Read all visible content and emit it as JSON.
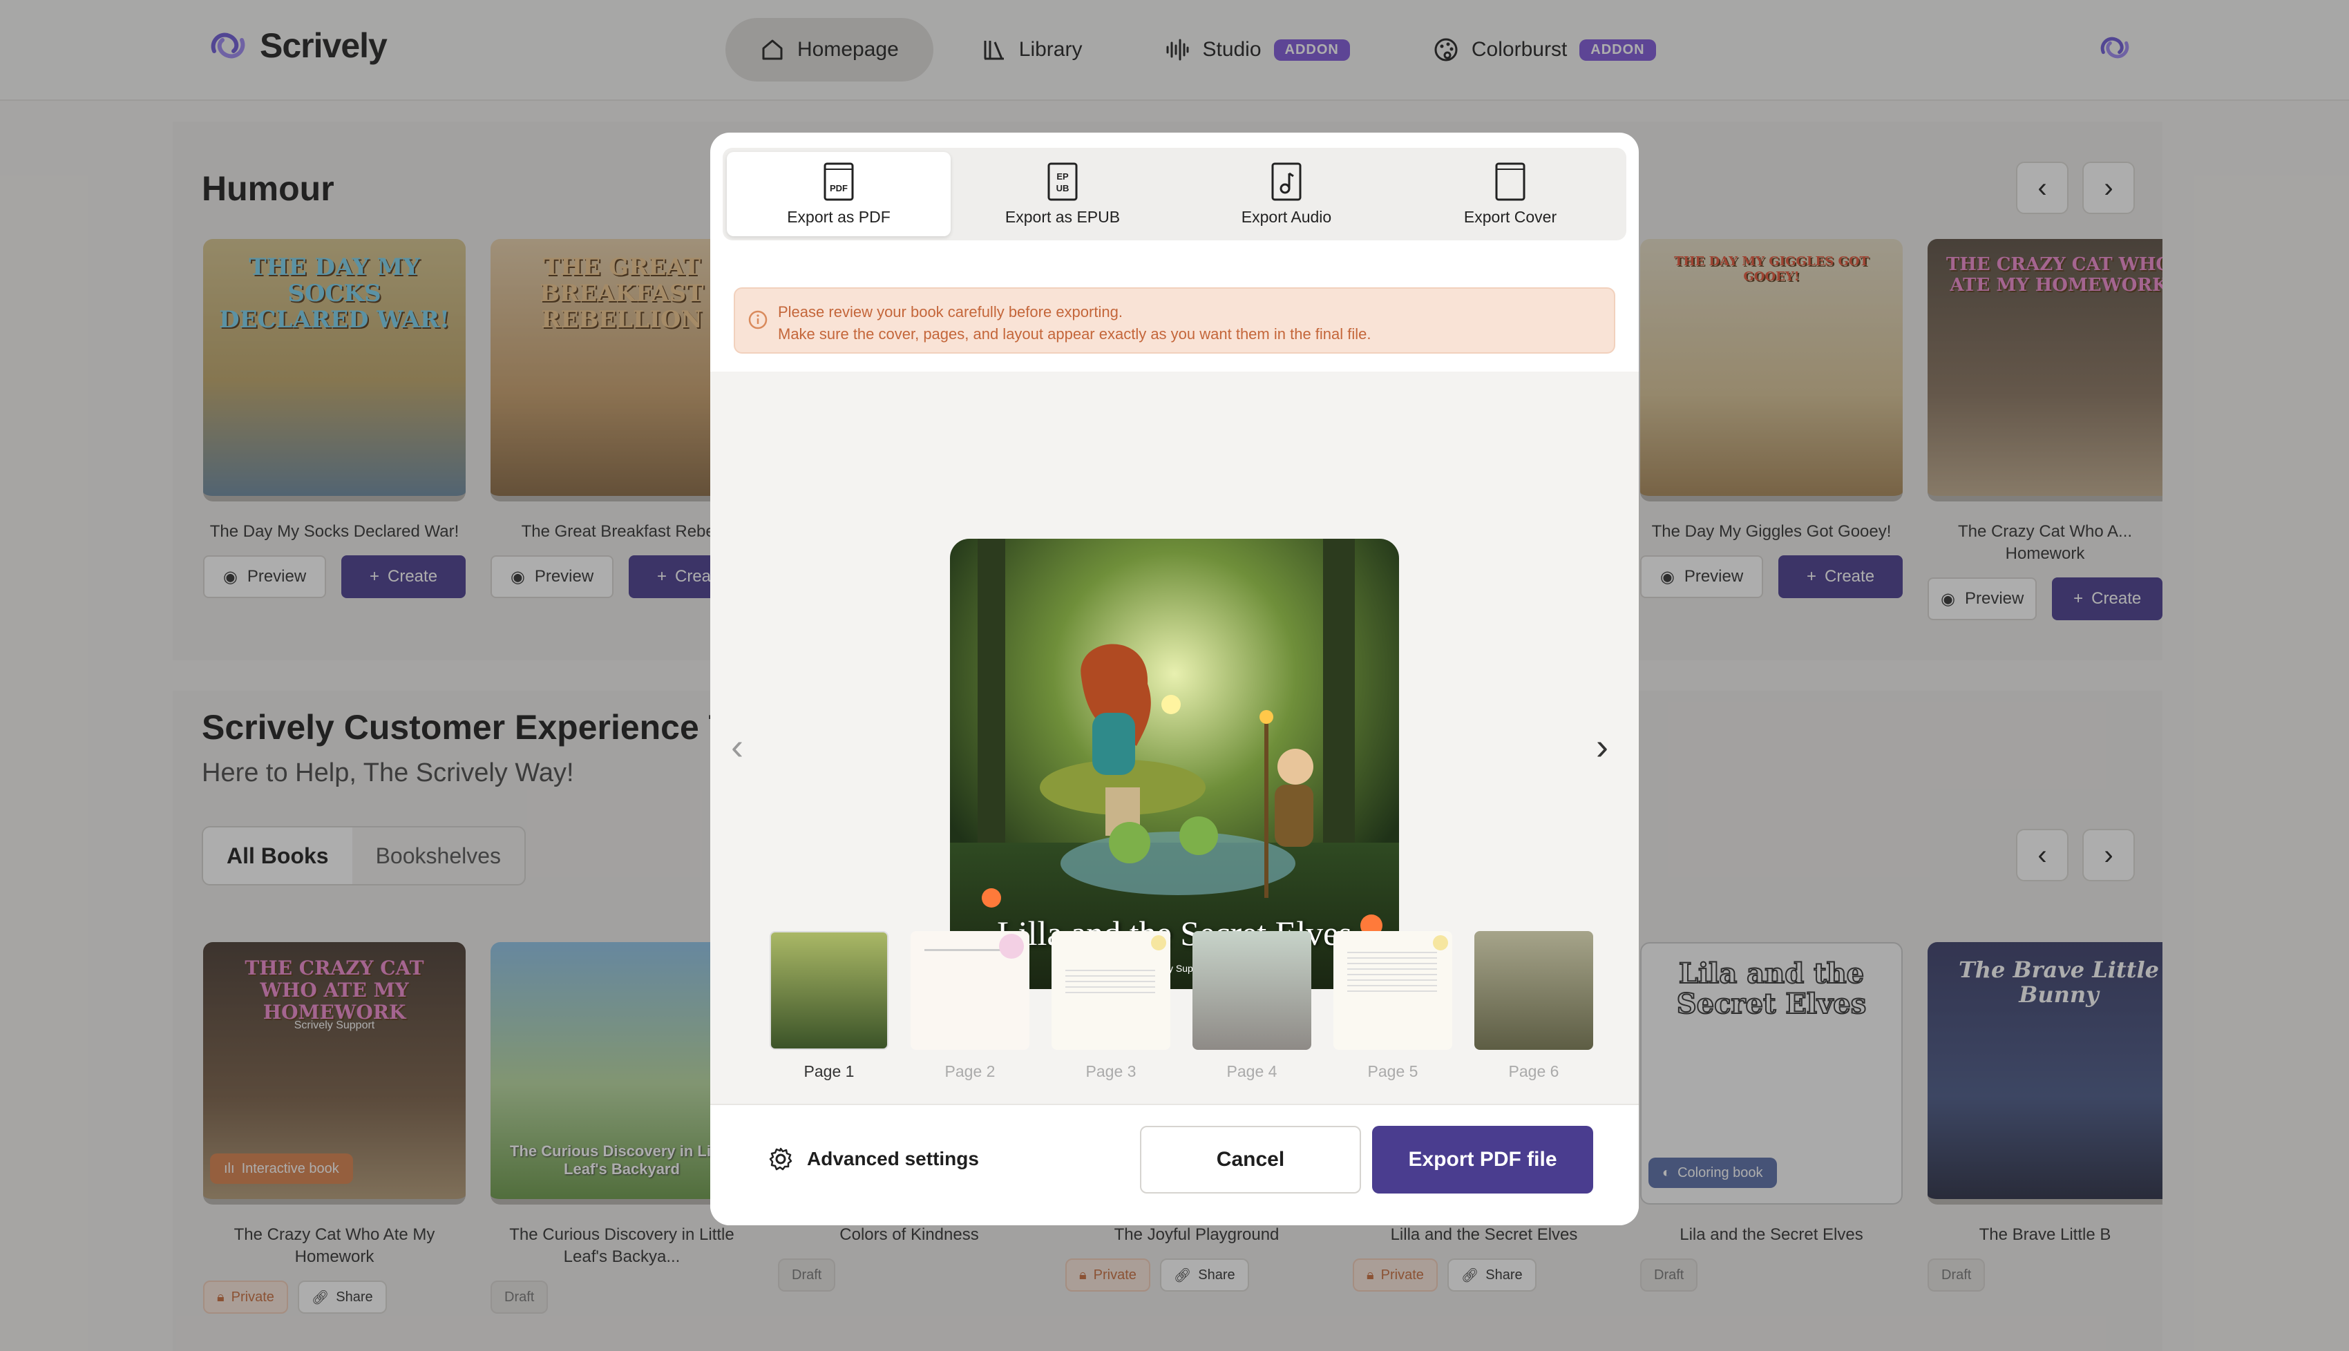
{
  "header": {
    "brand": "Scrively",
    "nav": [
      {
        "label": "Homepage"
      },
      {
        "label": "Library"
      },
      {
        "label": "Studio",
        "badge": "ADDON"
      },
      {
        "label": "Colorburst",
        "badge": "ADDON"
      }
    ]
  },
  "humour": {
    "title": "Humour",
    "books": [
      {
        "title": "The Day My Socks Declared War!",
        "cover_text": "THE DAY MY SOCKS DECLARED WAR!"
      },
      {
        "title": "The Great Breakfast Rebell",
        "cover_text": "THE GREAT BREAKFAST REBELLION"
      },
      {
        "title": "The Day My Giggles Got Gooey!",
        "cover_text": "THE DAY MY GIGGLES GOT GOOEY!"
      },
      {
        "title": "The Crazy Cat Who A... Homework",
        "cover_text": "THE CRAZY CAT WHO ATE MY HOMEWORK"
      }
    ],
    "preview_label": "Preview",
    "create_label": "Create"
  },
  "team": {
    "title": "Scrively Customer Experience Tea",
    "subtitle": "Here to Help, The Scrively Way!",
    "tabs": [
      "All Books",
      "Bookshelves"
    ],
    "books": [
      {
        "title": "The Crazy Cat Who Ate My Homework",
        "cover_text": "THE CRAZY CAT WHO ATE MY HOMEWORK",
        "cover_author": "Scrively Support",
        "badge": "Interactive book",
        "tags": [
          "Private",
          "Share"
        ]
      },
      {
        "title": "The Curious Discovery in Little Leaf's Backya...",
        "cover_text": "The Curious Discovery in Little Leaf's Backyard",
        "tags": [
          "Draft"
        ]
      },
      {
        "title": "Colors of Kindness",
        "tags": [
          "Draft"
        ]
      },
      {
        "title": "The Joyful Playground",
        "tags": [
          "Private",
          "Share"
        ]
      },
      {
        "title": "Lilla and the Secret Elves",
        "tags": [
          "Private",
          "Share"
        ]
      },
      {
        "title": "Lila and the Secret Elves",
        "cover_text": "Lila and the Secret Elves",
        "badge": "Coloring book",
        "tags": [
          "Draft"
        ]
      },
      {
        "title": "The Brave Little B",
        "cover_text": "The Brave Little Bunny",
        "tags": [
          "Draft"
        ]
      }
    ]
  },
  "modal": {
    "tabs": [
      {
        "label": "Export as PDF",
        "icon": "pdf-file-icon",
        "active": true
      },
      {
        "label": "Export as EPUB",
        "icon": "epub-file-icon"
      },
      {
        "label": "Export Audio",
        "icon": "audio-file-icon"
      },
      {
        "label": "Export Cover",
        "icon": "cover-icon"
      }
    ],
    "warning_line1": "Please review your book carefully before exporting.",
    "warning_line2": "Make sure the cover, pages, and layout appear exactly as you want them in the final file.",
    "preview": {
      "title": "Lilla and the Secret Elves",
      "author": "Scrively Support"
    },
    "pages": [
      "Page 1",
      "Page 2",
      "Page 3",
      "Page 4",
      "Page 5",
      "Page 6"
    ],
    "current_page": 1,
    "advanced_label": "Advanced settings",
    "cancel_label": "Cancel",
    "export_label": "Export PDF file"
  },
  "colors": {
    "primary": "#4a3d8f",
    "addon": "#7f57d8",
    "warning_bg": "#f9e3d6",
    "warning_text": "#c4663a"
  }
}
